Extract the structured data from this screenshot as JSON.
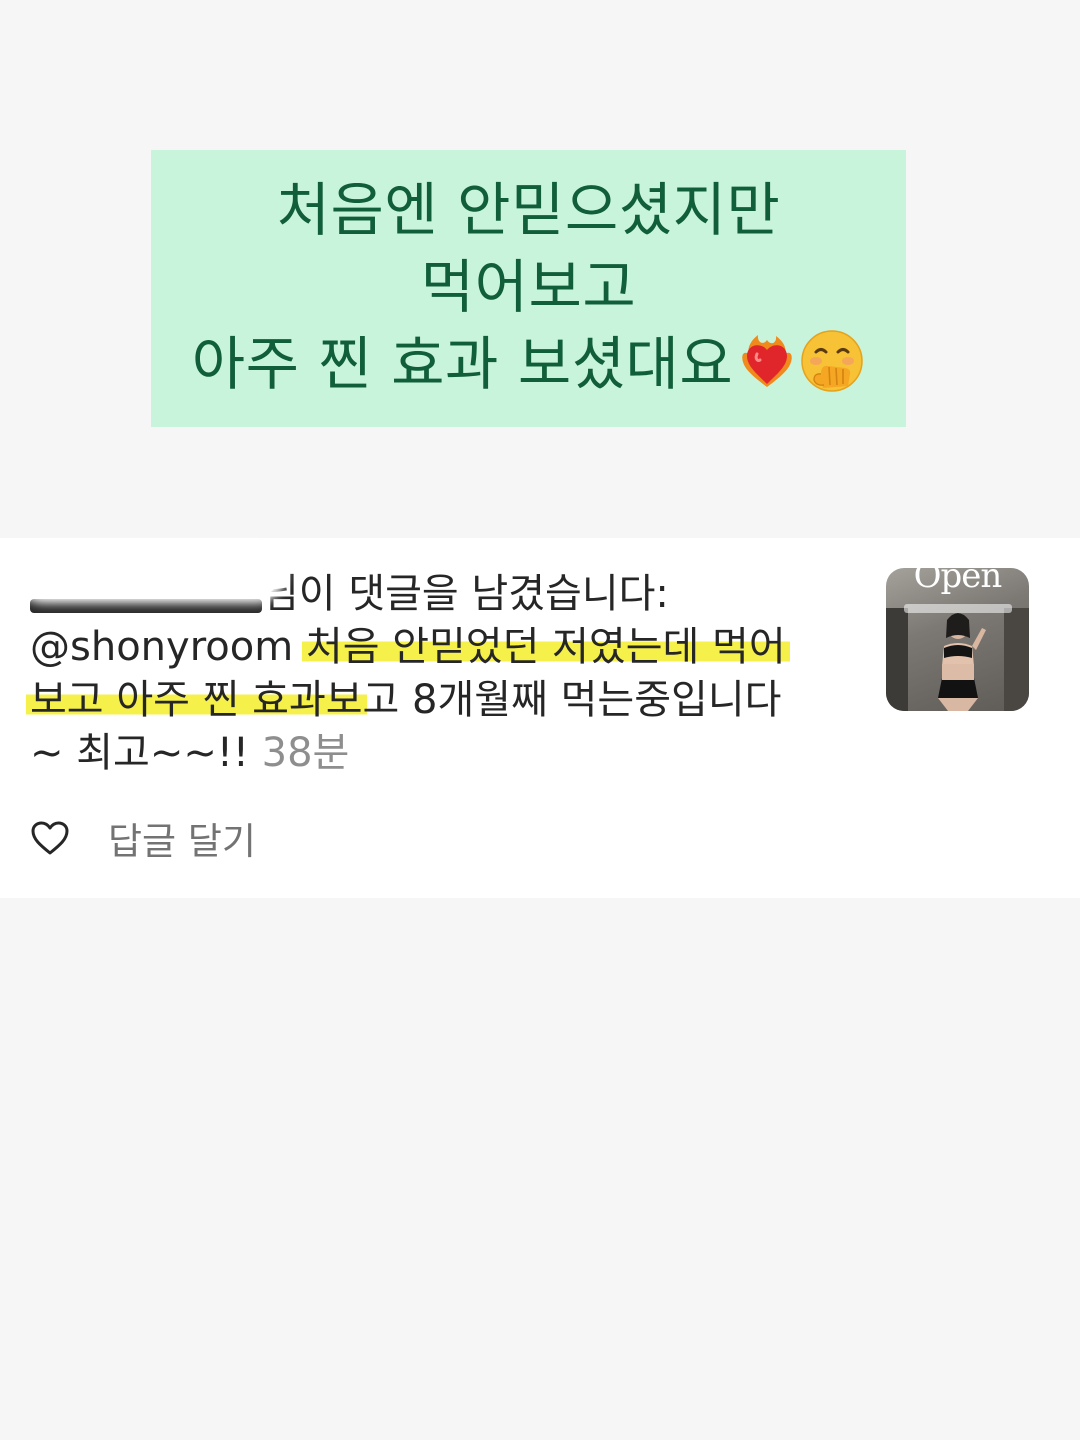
{
  "caption": {
    "line1": "처음엔 안믿으셨지만",
    "line2": "먹어보고",
    "line3": "아주 찐 효과 보셨대요",
    "emojis": [
      "heart-on-fire-emoji",
      "hand-over-mouth-face-emoji"
    ],
    "background": "#c9f4dc",
    "text_color": "#115e3a"
  },
  "comment": {
    "action_text": "님이 댓글을 남겼습니다:",
    "mention": "@shonyroom",
    "highlight_1": "처음 안믿었던 저였는데 먹어",
    "highlight_2": "보고 아주 찐 효과보",
    "rest_line2": "고 8개월째 먹는중입니다",
    "line3": "~ 최고~~!!",
    "timestamp": "38분",
    "highlight_color": "#f5f04a"
  },
  "thumbnail": {
    "title": "Open"
  },
  "actions": {
    "like_icon": "heart-outline-icon",
    "reply_label": "답글 달기"
  }
}
